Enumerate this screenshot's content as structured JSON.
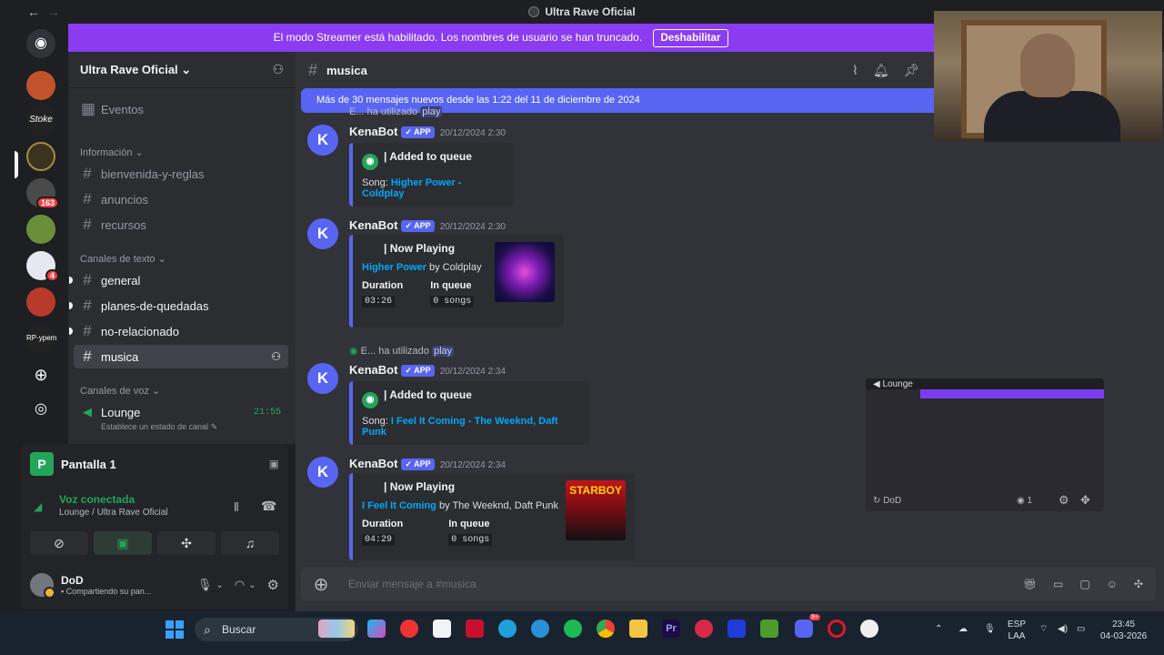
{
  "window": {
    "title": "Ultra Rave Oficial"
  },
  "streamer": {
    "text": "El modo Streamer está habilitado. Los nombres de usuario se han truncado.",
    "button": "Deshabilitar"
  },
  "server": {
    "name": "Ultra Rave Oficial"
  },
  "sidebar": {
    "events": "Eventos",
    "cat_info": "Información",
    "info_channels": [
      "bienvenida-y-reglas",
      "anuncios",
      "recursos"
    ],
    "cat_text": "Canales de texto",
    "text_channels": [
      "general",
      "planes-de-quedadas",
      "no-relacionado",
      "musica"
    ],
    "cat_voice": "Canales de voz",
    "voice_channel": "Lounge",
    "voice_timer": "21:55",
    "voice_status_hint": "Establece un estado de canal"
  },
  "screen_share": {
    "label": "Pantalla 1"
  },
  "voice": {
    "status": "Voz conectada",
    "location": "Lounge / Ultra Rave Oficial"
  },
  "user": {
    "name": "DoD",
    "status": "Compartiendo su pan..."
  },
  "chat": {
    "channel": "musica",
    "new_messages": "Más de 30 mensajes nuevos desde las 1:22 del 11 de diciembre de 2024",
    "used_prefix": "E... ha utilizado",
    "used_partial": "E... ha utilizado",
    "used_command": "play",
    "messages": [
      {
        "author": "KenaBot",
        "badge": "APP",
        "time": "20/12/2024 2:30",
        "title": "| Added to queue",
        "song_label": "Song:",
        "song": "Higher Power - Coldplay"
      },
      {
        "author": "KenaBot",
        "badge": "APP",
        "time": "20/12/2024 2:30",
        "title": "| Now Playing",
        "song": "Higher Power",
        "by": "by Coldplay",
        "duration_label": "Duration",
        "duration": "03:26",
        "queue_label": "In queue",
        "queue": "0 songs"
      },
      {
        "author": "KenaBot",
        "badge": "APP",
        "time": "20/12/2024 2:34",
        "title": "| Added to queue",
        "song_label": "Song:",
        "song": "I Feel It Coming - The Weeknd, Daft Punk"
      },
      {
        "author": "KenaBot",
        "badge": "APP",
        "time": "20/12/2024 2:34",
        "title": "| Now Playing",
        "song": "I Feel It Coming",
        "by": "by The Weeknd, Daft Punk",
        "duration_label": "Duration",
        "duration": "04:29",
        "queue_label": "In queue",
        "queue": "0 songs",
        "art_text": "STARBOY"
      }
    ],
    "composer_placeholder": "Enviar mensaje a #musica"
  },
  "stream_preview": {
    "channel": "Lounge",
    "name": "DoD",
    "viewers": "1"
  },
  "guild_badges": {
    "b1": "163",
    "b2": "4"
  },
  "guild_labels": {
    "stoke": "Stoke",
    "rp": "RP·ypem"
  },
  "taskbar": {
    "search": "Buscar",
    "lang1": "ESP",
    "lang2": "LAA",
    "time": "23:45",
    "date": "04-03-2026",
    "discord_badge": "9+"
  },
  "colors": {
    "accent": "#5865f2",
    "streamer": "#8b3cf0",
    "link": "#00a8fc",
    "online": "#23a559"
  }
}
